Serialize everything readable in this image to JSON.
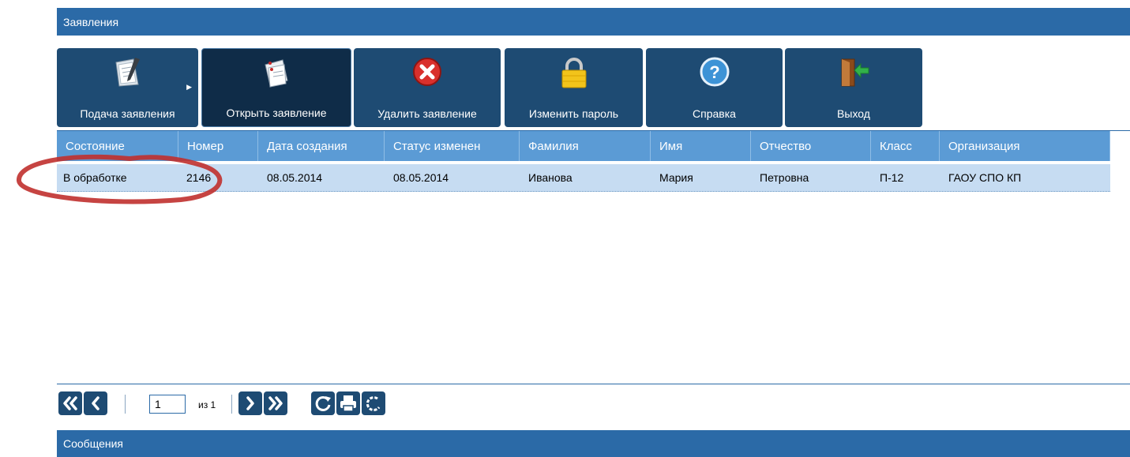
{
  "panel": {
    "title": "Заявления"
  },
  "toolbar": {
    "buttons": [
      {
        "label": "Подача заявления",
        "icon": "document-edit-icon"
      },
      {
        "label": "Открыть заявление",
        "icon": "open-documents-icon"
      },
      {
        "label": "Удалить заявление",
        "icon": "delete-x-icon"
      },
      {
        "label": "Изменить пароль",
        "icon": "padlock-icon"
      },
      {
        "label": "Справка",
        "icon": "help-icon"
      },
      {
        "label": "Выход",
        "icon": "exit-door-icon"
      }
    ]
  },
  "grid": {
    "columns": [
      "Состояние",
      "Номер",
      "Дата создания",
      "Статус изменен",
      "Фамилия",
      "Имя",
      "Отчество",
      "Класс",
      "Организация"
    ],
    "rows": [
      {
        "status": "В обработке",
        "number": "2146",
        "created": "08.05.2014",
        "status_changed": "08.05.2014",
        "last_name": "Иванова",
        "first_name": "Мария",
        "patronymic": "Петровна",
        "class": "П-12",
        "organization": "ГАОУ СПО КП"
      }
    ]
  },
  "pager": {
    "page": "1",
    "of_label": "из 1"
  },
  "messages": {
    "title": "Сообщения"
  },
  "colors": {
    "header_blue": "#2b6aa7",
    "toolbar_button": "#1e4b73",
    "grid_header": "#5b9bd5",
    "selected_row": "#c6dcf2",
    "annotation_red": "#c0302e"
  }
}
